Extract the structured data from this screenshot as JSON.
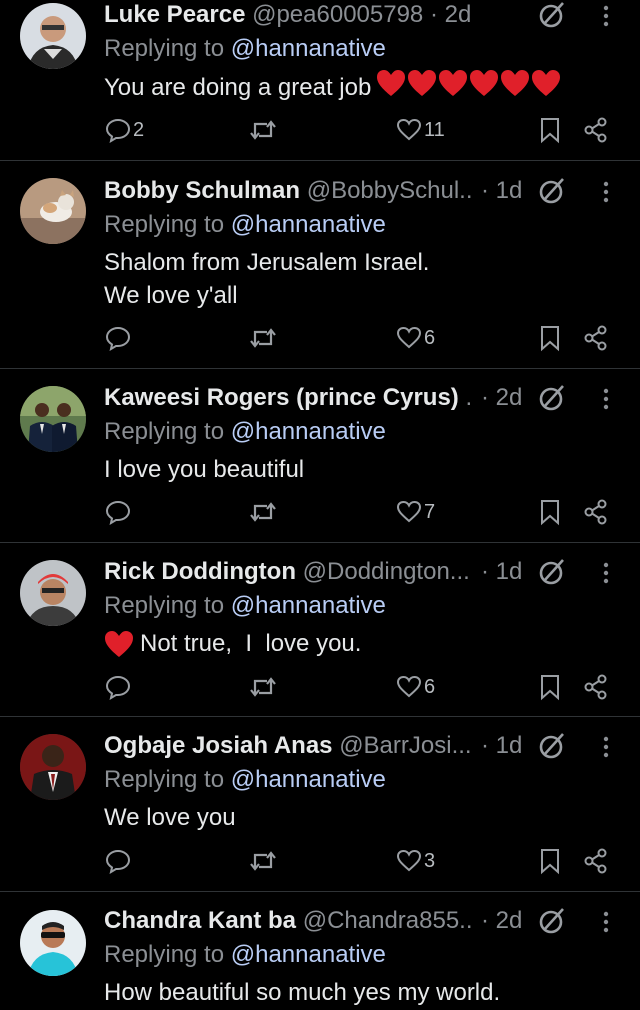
{
  "reply_prefix": "Replying to",
  "tweets": [
    {
      "name": "Luke Pearce",
      "handle": "@pea60005798",
      "time": "· 2d",
      "mention": "@hannanative",
      "lines": [
        "You are doing a great job"
      ],
      "heart_emojis": 6,
      "replies": "2",
      "likes": "11"
    },
    {
      "name": "Bobby Schulman",
      "handle": "@BobbySchul...",
      "time": "· 1d",
      "mention": "@hannanative",
      "lines": [
        "Shalom from Jerusalem Israel.",
        "We love y'all"
      ],
      "replies": "",
      "likes": "6"
    },
    {
      "name": "Kaweesi Rogers (prince Cyrus)",
      "handle": "...",
      "time": "· 2d",
      "mention": "@hannanative",
      "lines": [
        "I love you beautiful"
      ],
      "replies": "",
      "likes": "7"
    },
    {
      "name": "Rick Doddington",
      "handle": "@Doddington...",
      "time": "· 1d",
      "mention": "@hannanative",
      "lines": [
        "Not true,  I  love you."
      ],
      "replies": "",
      "likes": "6"
    },
    {
      "name": "Ogbaje Josiah Anas",
      "handle": "@BarrJosi...",
      "time": "· 1d",
      "mention": "@hannanative",
      "lines": [
        "We love you"
      ],
      "replies": "",
      "likes": "3"
    },
    {
      "name": "Chandra Kant ba",
      "handle": "@Chandra855...",
      "time": "· 2d",
      "mention": "@hannanative",
      "lines": [
        "How beautiful so much yes my world."
      ],
      "replies": "",
      "likes": ""
    }
  ],
  "icons": {
    "reply": "reply-icon",
    "retweet": "retweet-icon",
    "like": "heart-icon",
    "bookmark": "bookmark-icon",
    "share": "share-icon",
    "grok": "grok-icon",
    "more": "more-vertical-icon",
    "heart_emoji": "red-heart-emoji"
  },
  "colors": {
    "background": "#000000",
    "text": "#e7e9ea",
    "muted": "#8b8f94",
    "mention": "#b9cdf5",
    "divider": "#2f3336",
    "heart_emoji": "#e0202a"
  }
}
